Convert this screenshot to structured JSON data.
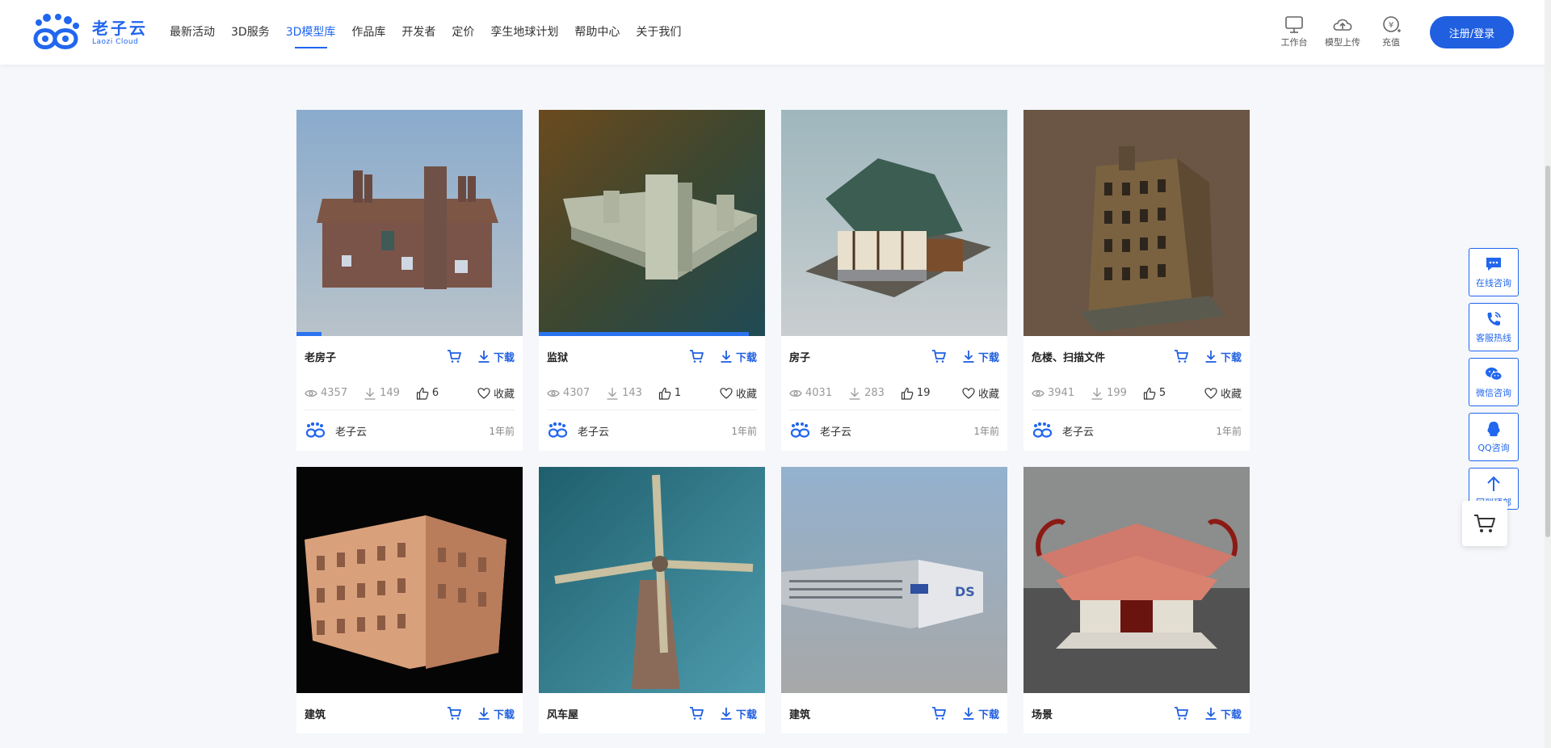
{
  "brand": {
    "name_cn": "老子云",
    "name_en": "Laozi Cloud",
    "color": "#2166ee"
  },
  "nav": [
    {
      "label": "最新活动",
      "active": false
    },
    {
      "label": "3D服务",
      "active": false
    },
    {
      "label": "3D模型库",
      "active": true
    },
    {
      "label": "作品库",
      "active": false
    },
    {
      "label": "开发者",
      "active": false
    },
    {
      "label": "定价",
      "active": false
    },
    {
      "label": "孪生地球计划",
      "active": false
    },
    {
      "label": "帮助中心",
      "active": false
    },
    {
      "label": "关于我们",
      "active": false
    }
  ],
  "tools": [
    {
      "label": "工作台",
      "icon": "monitor-icon"
    },
    {
      "label": "模型上传",
      "icon": "cloud-upload-icon"
    },
    {
      "label": "充值",
      "icon": "yen-plus-icon"
    }
  ],
  "login_label": "注册/登录",
  "download_label": "下载",
  "fav_label": "收藏",
  "cards": [
    {
      "title": "老房子",
      "views": "4357",
      "downloads": "149",
      "likes": "6",
      "author": "老子云",
      "time": "1年前",
      "progress": 0.11
    },
    {
      "title": "监狱",
      "views": "4307",
      "downloads": "143",
      "likes": "1",
      "author": "老子云",
      "time": "1年前",
      "progress": 0.93
    },
    {
      "title": "房子",
      "views": "4031",
      "downloads": "283",
      "likes": "19",
      "author": "老子云",
      "time": "1年前",
      "progress": 0
    },
    {
      "title": "危楼、扫描文件",
      "views": "3941",
      "downloads": "199",
      "likes": "5",
      "author": "老子云",
      "time": "1年前",
      "progress": 0
    },
    {
      "title": "建筑",
      "views": "",
      "downloads": "",
      "likes": "",
      "author": "",
      "time": "",
      "progress": 0
    },
    {
      "title": "风车屋",
      "views": "",
      "downloads": "",
      "likes": "",
      "author": "",
      "time": "",
      "progress": 0
    },
    {
      "title": "建筑",
      "views": "",
      "downloads": "",
      "likes": "",
      "author": "",
      "time": "",
      "progress": 0
    },
    {
      "title": "场景",
      "views": "",
      "downloads": "",
      "likes": "",
      "author": "",
      "time": "",
      "progress": 0
    }
  ],
  "side_buttons": [
    {
      "label": "在线咨询",
      "icon": "chat-icon"
    },
    {
      "label": "客服热线",
      "icon": "phone-icon"
    },
    {
      "label": "微信咨询",
      "icon": "wechat-icon"
    },
    {
      "label": "QQ咨询",
      "icon": "qq-icon"
    },
    {
      "label": "回到顶部",
      "icon": "arrow-up-icon"
    }
  ]
}
